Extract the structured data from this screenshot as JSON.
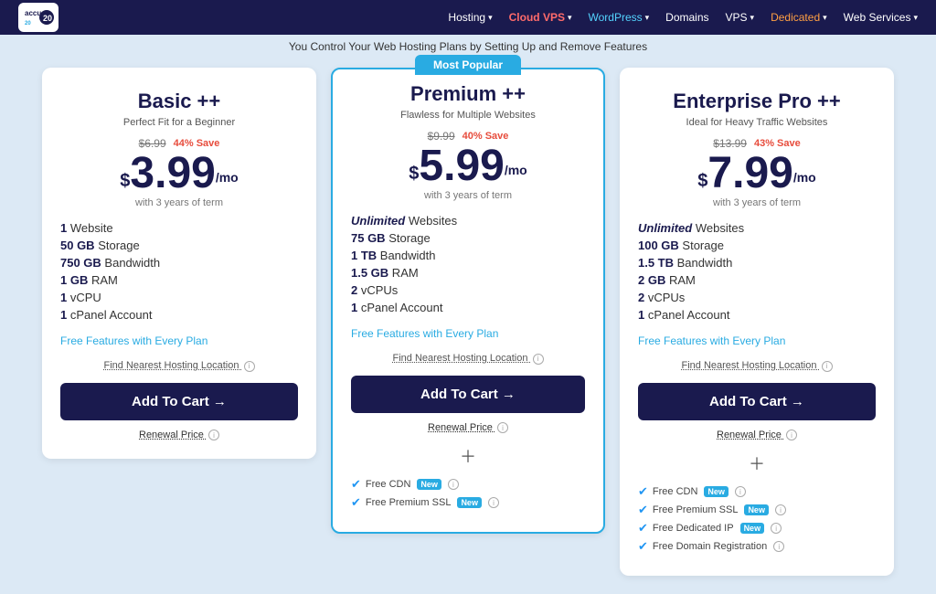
{
  "navbar": {
    "logo_text": "accu",
    "logo_subtext": "WEB HOSTING",
    "nav_items": [
      {
        "label": "Hosting",
        "has_dropdown": true
      },
      {
        "label": "Cloud VPS",
        "has_dropdown": true,
        "badge": "vps"
      },
      {
        "label": "WordPress",
        "has_dropdown": true,
        "badge": "wp"
      },
      {
        "label": "Domains",
        "has_dropdown": false
      },
      {
        "label": "VPS",
        "has_dropdown": true
      },
      {
        "label": "Dedicated",
        "has_dropdown": true,
        "badge": "dedicated"
      },
      {
        "label": "Web Services",
        "has_dropdown": true
      }
    ]
  },
  "subheader": {
    "text": "You Control Your Web Hosting Plans by Setting Up and Remove Features"
  },
  "plans": [
    {
      "id": "basic",
      "featured": false,
      "title": "Basic ++",
      "subtitle": "Perfect Fit for a Beginner",
      "original_price": "$6.99",
      "save_text": "44% Save",
      "price_dollar": "$",
      "price_main": "3.99",
      "price_suffix": "/mo",
      "price_term": "with 3 years of term",
      "features": [
        {
          "text": "1 Website",
          "bold": "1 Website"
        },
        {
          "text": "50 GB Storage",
          "bold": "50 GB"
        },
        {
          "text": "750 GB Bandwidth",
          "bold": "750 GB"
        },
        {
          "text": "1 GB RAM",
          "bold": "1 GB"
        },
        {
          "text": "1 vCPU",
          "bold": "1"
        },
        {
          "text": "1 cPanel Account",
          "bold": "1"
        }
      ],
      "free_features_label": "Free Features with Every Plan",
      "hosting_location_label": "Find Nearest Hosting Location",
      "cart_button": "Add To Cart →",
      "renewal_label": "Renewal Price",
      "extras": []
    },
    {
      "id": "premium",
      "featured": true,
      "most_popular_label": "Most Popular",
      "title": "Premium ++",
      "subtitle": "Flawless for Multiple Websites",
      "original_price": "$9.99",
      "save_text": "40% Save",
      "price_dollar": "$",
      "price_main": "5.99",
      "price_suffix": "/mo",
      "price_term": "with 3 years of term",
      "features": [
        {
          "text": "Unlimited Websites",
          "bold": "Unlimited",
          "unlimited": true
        },
        {
          "text": "75 GB Storage",
          "bold": "75 GB"
        },
        {
          "text": "1 TB Bandwidth",
          "bold": "1 TB"
        },
        {
          "text": "1.5 GB RAM",
          "bold": "1.5 GB"
        },
        {
          "text": "2 vCPUs",
          "bold": "2"
        },
        {
          "text": "1 cPanel Account",
          "bold": "1"
        }
      ],
      "free_features_label": "Free Features with Every Plan",
      "hosting_location_label": "Find Nearest Hosting Location",
      "cart_button": "Add To Cart →",
      "renewal_label": "Renewal Price",
      "extras": [
        {
          "label": "Free CDN",
          "badge": "New"
        },
        {
          "label": "Free Premium SSL",
          "badge": "New"
        }
      ]
    },
    {
      "id": "enterprise",
      "featured": false,
      "title": "Enterprise Pro ++",
      "subtitle": "Ideal for Heavy Traffic Websites",
      "original_price": "$13.99",
      "save_text": "43% Save",
      "price_dollar": "$",
      "price_main": "7.99",
      "price_suffix": "/mo",
      "price_term": "with 3 years of term",
      "features": [
        {
          "text": "Unlimited Websites",
          "bold": "Unlimited",
          "unlimited": true
        },
        {
          "text": "100 GB Storage",
          "bold": "100 GB"
        },
        {
          "text": "1.5 TB Bandwidth",
          "bold": "1.5 TB"
        },
        {
          "text": "2 GB RAM",
          "bold": "2 GB"
        },
        {
          "text": "2 vCPUs",
          "bold": "2"
        },
        {
          "text": "1 cPanel Account",
          "bold": "1"
        }
      ],
      "free_features_label": "Free Features with Every Plan",
      "hosting_location_label": "Find Nearest Hosting Location",
      "cart_button": "Add To Cart →",
      "renewal_label": "Renewal Price",
      "extras": [
        {
          "label": "Free CDN",
          "badge": "New"
        },
        {
          "label": "Free Premium SSL",
          "badge": "New"
        },
        {
          "label": "Free Dedicated IP",
          "badge": "New"
        },
        {
          "label": "Free Domain Registration",
          "badge": ""
        }
      ]
    }
  ]
}
